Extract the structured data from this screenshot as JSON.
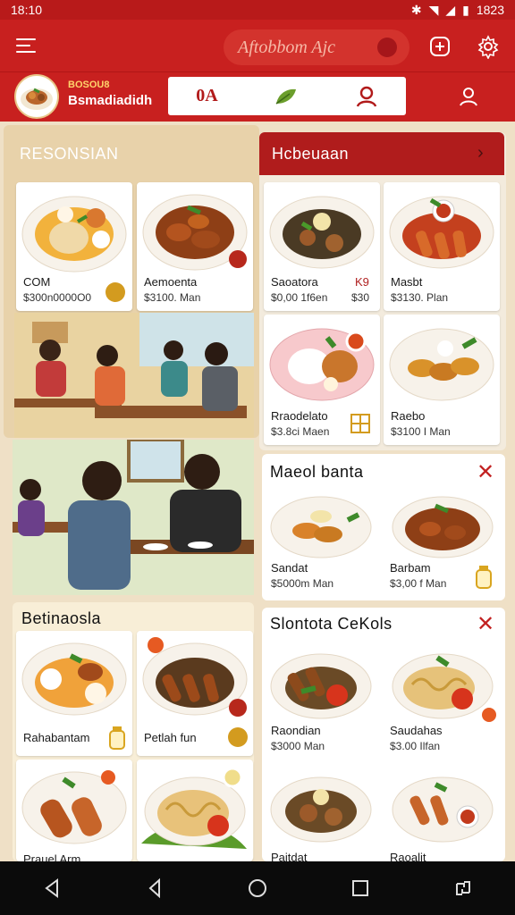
{
  "status": {
    "time": "18:10",
    "battery": "1823"
  },
  "toolbar": {
    "search_text": "Aftobbom Ajc"
  },
  "header": {
    "brand_sub": "BOSOU8",
    "brand_name": "Bsmadiadidh",
    "tab_label": "0A"
  },
  "left_section": {
    "title": "RESONSIAN",
    "cards": [
      {
        "name": "COM",
        "price": "$300n0000O0"
      },
      {
        "name": "Aemoenta",
        "price": "$3100. Man"
      }
    ]
  },
  "right_section": {
    "title": "Hcbeuaan",
    "cards": [
      {
        "name": "Saoatora",
        "price": "$0,00 1f6en",
        "extra1": "K9",
        "extra2": "$30"
      },
      {
        "name": "Masbt",
        "price": "$3130. Plan"
      },
      {
        "name": "Rraodelato",
        "price": "$3.8ci Maen"
      },
      {
        "name": "Raebo",
        "price": "$3100 I Man"
      }
    ]
  },
  "mid_right_section": {
    "title": "Maeol banta",
    "cards": [
      {
        "name": "Sandat",
        "price": "$5000m Man"
      },
      {
        "name": "Barbam",
        "price": "$3,00 f Man"
      }
    ]
  },
  "bottom_left_section": {
    "title": "Betinaosla",
    "cards": [
      {
        "name": "Rahabantam",
        "price": ""
      },
      {
        "name": "Petlah fun",
        "price": ""
      },
      {
        "name": "Prauel Arm",
        "price": ""
      },
      {
        "name": "",
        "price": ""
      }
    ]
  },
  "bottom_right_section": {
    "title": "Slontota CeKols",
    "cards": [
      {
        "name": "Raondian",
        "price": "$3000 Man"
      },
      {
        "name": "Saudahas",
        "price": "$3.00 Ilfan"
      },
      {
        "name": "Paitdat",
        "price": ""
      },
      {
        "name": "Raoalit",
        "price": ""
      }
    ]
  }
}
